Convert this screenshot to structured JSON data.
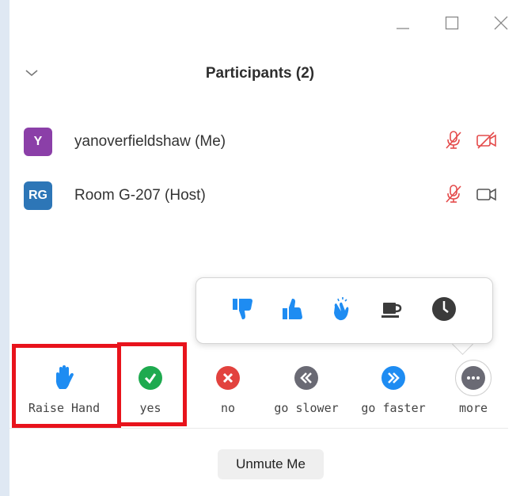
{
  "window": {
    "title": "Participants (2)",
    "controls": [
      "minimize-icon",
      "maximize-icon",
      "close-icon"
    ]
  },
  "participants": [
    {
      "initials": "Y",
      "name": "yanoverfieldshaw (Me)",
      "avatar_color": "#8b3fa8",
      "audio": "muted",
      "video": "off"
    },
    {
      "initials": "RG",
      "name": "Room G-207 (Host)",
      "avatar_color": "#2d76b7",
      "audio": "muted",
      "video": "on"
    }
  ],
  "reactions": [
    "thumbs-down-icon",
    "thumbs-up-icon",
    "clap-icon",
    "coffee-icon",
    "clock-icon"
  ],
  "feedback": [
    {
      "label": "Raise Hand",
      "icon": "raise-hand-icon"
    },
    {
      "label": "yes",
      "icon": "yes-check-icon"
    },
    {
      "label": "no",
      "icon": "no-x-icon"
    },
    {
      "label": "go slower",
      "icon": "go-slower-icon"
    },
    {
      "label": "go faster",
      "icon": "go-faster-icon"
    },
    {
      "label": "more",
      "icon": "more-icon"
    }
  ],
  "unmute_label": "Unmute Me",
  "colors": {
    "accent_blue": "#1e8cf2",
    "yes_green": "#1eaa4f",
    "no_red": "#e2423e",
    "neutral_gray": "#6a6a74",
    "muted_red": "#e44b4b",
    "highlight_red": "#e8131c"
  }
}
